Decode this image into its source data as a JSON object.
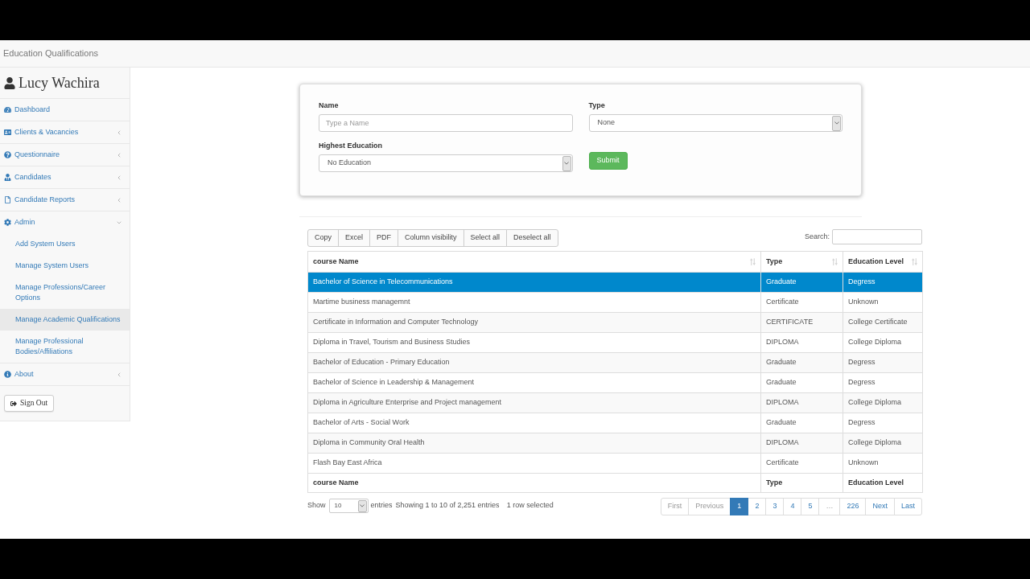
{
  "top_bar": {
    "title": "Education Qualifications"
  },
  "sidebar": {
    "user": "Lucy Wachira",
    "items": [
      {
        "label": "Dashboard",
        "kind": "link"
      },
      {
        "label": "Clients & Vacancies",
        "kind": "group",
        "expanded": false
      },
      {
        "label": "Questionnaire",
        "kind": "group",
        "expanded": false
      },
      {
        "label": "Candidates",
        "kind": "group",
        "expanded": false
      },
      {
        "label": "Candidate Reports",
        "kind": "group",
        "expanded": false
      },
      {
        "label": "Admin",
        "kind": "group",
        "expanded": true,
        "children": [
          {
            "label": "Add System Users",
            "selected": false
          },
          {
            "label": "Manage System Users",
            "selected": false
          },
          {
            "label": "Manage Professions/Career Options",
            "selected": false
          },
          {
            "label": "Manage Academic Qualifications",
            "selected": true
          },
          {
            "label": "Manage Professional Bodies/Affiliations",
            "selected": false
          }
        ]
      },
      {
        "label": "About",
        "kind": "group",
        "expanded": false
      }
    ],
    "sign_out": "Sign Out"
  },
  "filter_form": {
    "fields": [
      {
        "label": "Name",
        "kind": "text",
        "placeholder": "Type a Name"
      },
      {
        "label": "Type",
        "kind": "select",
        "value": "None"
      },
      {
        "label": "Highest Education",
        "kind": "select",
        "value": "No Education"
      }
    ],
    "submit": "Submit"
  },
  "table": {
    "buttons": [
      "Copy",
      "Excel",
      "PDF",
      "Column visibility",
      "Select all",
      "Deselect all"
    ],
    "search": {
      "label": "Search:"
    },
    "columns": [
      "course Name",
      "Type",
      "Education Level"
    ],
    "rows": [
      {
        "cells": [
          "Bachelor of Science in Telecommunications",
          "Graduate",
          "Degress"
        ],
        "selected": true
      },
      {
        "cells": [
          "Martime business managemnt",
          "Certificate",
          "Unknown"
        ],
        "selected": false
      },
      {
        "cells": [
          "Certificate in Information and Computer Technology",
          "CERTIFICATE",
          "College Certificate"
        ],
        "selected": false
      },
      {
        "cells": [
          "Diploma in Travel, Tourism and Business Studies",
          "DIPLOMA",
          "College Diploma"
        ],
        "selected": false
      },
      {
        "cells": [
          "Bachelor of Education - Primary Education",
          "Graduate",
          "Degress"
        ],
        "selected": false
      },
      {
        "cells": [
          "Bachelor of Science in Leadership & Management",
          "Graduate",
          "Degress"
        ],
        "selected": false
      },
      {
        "cells": [
          "Diploma in Agriculture Enterprise and Project management",
          "DIPLOMA",
          "College Diploma"
        ],
        "selected": false
      },
      {
        "cells": [
          "Bachelor of Arts - Social Work",
          "Graduate",
          "Degress"
        ],
        "selected": false
      },
      {
        "cells": [
          "Diploma in Community Oral Health",
          "DIPLOMA",
          "College Diploma"
        ],
        "selected": false
      },
      {
        "cells": [
          "Flash Bay East Africa",
          "Certificate",
          "Unknown"
        ],
        "selected": false
      }
    ],
    "footer": [
      "course Name",
      "Type",
      "Education Level"
    ],
    "length": {
      "before": "Show",
      "value": "10",
      "after": "entries"
    },
    "info": "Showing 1 to 10 of 2,251 entries",
    "selection_info": "1 row selected",
    "pagination": [
      {
        "label": "First",
        "selected": false,
        "disabled": true
      },
      {
        "label": "Previous",
        "selected": false,
        "disabled": true
      },
      {
        "label": "1",
        "selected": true,
        "disabled": false
      },
      {
        "label": "2",
        "selected": false,
        "disabled": false
      },
      {
        "label": "3",
        "selected": false,
        "disabled": false
      },
      {
        "label": "4",
        "selected": false,
        "disabled": false
      },
      {
        "label": "5",
        "selected": false,
        "disabled": false
      },
      {
        "label": "…",
        "selected": false,
        "disabled": true
      },
      {
        "label": "226",
        "selected": false,
        "disabled": false
      },
      {
        "label": "Next",
        "selected": false,
        "disabled": false
      },
      {
        "label": "Last",
        "selected": false,
        "disabled": false
      }
    ]
  }
}
